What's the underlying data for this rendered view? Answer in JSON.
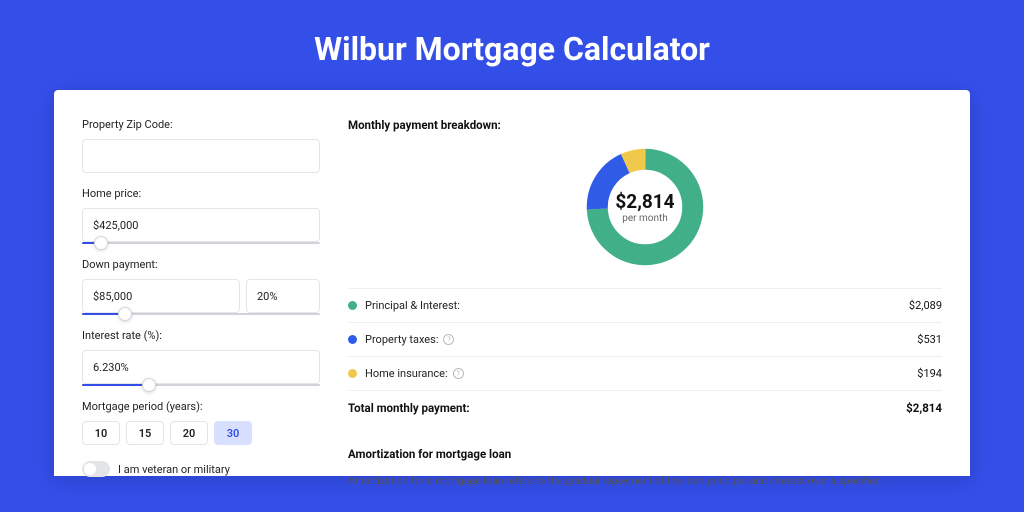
{
  "page_title": "Wilbur Mortgage Calculator",
  "form": {
    "zip_label": "Property Zip Code:",
    "zip_value": "",
    "home_price_label": "Home price:",
    "home_price_value": "$425,000",
    "home_price_slider_pct": 8,
    "down_payment_label": "Down payment:",
    "down_payment_amount": "$85,000",
    "down_payment_pct": "20%",
    "down_payment_slider_pct": 18,
    "interest_label": "Interest rate (%):",
    "interest_value": "6.230%",
    "interest_slider_pct": 28,
    "period_label": "Mortgage period (years):",
    "period_options": [
      "10",
      "15",
      "20",
      "30"
    ],
    "period_selected": "30",
    "veteran_label": "I am veteran or military",
    "veteran_on": false
  },
  "breakdown": {
    "heading": "Monthly payment breakdown:",
    "center_amount": "$2,814",
    "center_sub": "per month",
    "items": [
      {
        "label": "Principal & Interest:",
        "amount": "$2,089",
        "color": "#41b088",
        "help": false
      },
      {
        "label": "Property taxes:",
        "amount": "$531",
        "color": "#2f5be7",
        "help": true
      },
      {
        "label": "Home insurance:",
        "amount": "$194",
        "color": "#f1c84c",
        "help": true
      }
    ],
    "total_label": "Total monthly payment:",
    "total_amount": "$2,814"
  },
  "chart_data": {
    "type": "pie",
    "title": "Monthly payment breakdown",
    "slices": [
      {
        "name": "Principal & Interest",
        "value": 2089,
        "color": "#41b088"
      },
      {
        "name": "Property taxes",
        "value": 531,
        "color": "#2f5be7"
      },
      {
        "name": "Home insurance",
        "value": 194,
        "color": "#f1c84c"
      }
    ],
    "total": 2814,
    "center_label": "$2,814 per month"
  },
  "amort": {
    "heading": "Amortization for mortgage loan",
    "body": "Amortization for a mortgage loan refers to the gradual repayment of the loan principal and interest over a specified"
  }
}
